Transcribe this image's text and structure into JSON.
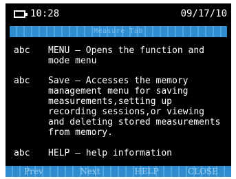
{
  "status": {
    "time": "10:28",
    "date": "09/17/10"
  },
  "title": "Measure Tab",
  "help_items": [
    {
      "key": "abc",
      "text": "MENU – Opens the function and\nmode menu"
    },
    {
      "key": "abc",
      "text": "Save – Accesses the memory\nmanagement menu for saving\nmeasurements,setting up\nrecording sessions,or viewing\nand deleting stored measurements\nfrom memory."
    },
    {
      "key": "abc",
      "text": "HELP – help information"
    }
  ],
  "softkeys": [
    "Prev",
    "Next",
    "HELP",
    "CLOSE"
  ],
  "colors": {
    "screen_bg": "#000000",
    "bar_blue": "#2f8ccf",
    "text": "#ffffff"
  }
}
